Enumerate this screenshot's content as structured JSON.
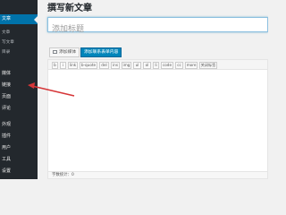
{
  "sidebar": {
    "items": [
      {
        "label": "文章",
        "current": true
      },
      {
        "label": "文章",
        "sub": true
      },
      {
        "label": "写文章",
        "sub": true
      },
      {
        "label": "目录",
        "sub": true
      },
      {
        "label": "媒体"
      },
      {
        "label": "链接"
      },
      {
        "label": "页面"
      },
      {
        "label": "评论"
      },
      {
        "label": "外观"
      },
      {
        "label": "插件"
      },
      {
        "label": "用户"
      },
      {
        "label": "工具"
      },
      {
        "label": "设置"
      }
    ]
  },
  "page": {
    "title": "撰写新文章",
    "title_placeholder": "添加标题"
  },
  "buttons": {
    "add_media": "添加媒体",
    "add_form": "添加联系表单内容"
  },
  "toolbar": {
    "tags": [
      "b",
      "i",
      "link",
      "b-quote",
      "del",
      "ins",
      "img",
      "ul",
      "ol",
      "li",
      "code",
      "cc",
      "more",
      "关闭标签"
    ]
  },
  "status": {
    "word_count": "字数统计：0"
  },
  "colors": {
    "sidebar_bg": "#23282d",
    "accent": "#0073aa",
    "arrow": "#d63638"
  }
}
